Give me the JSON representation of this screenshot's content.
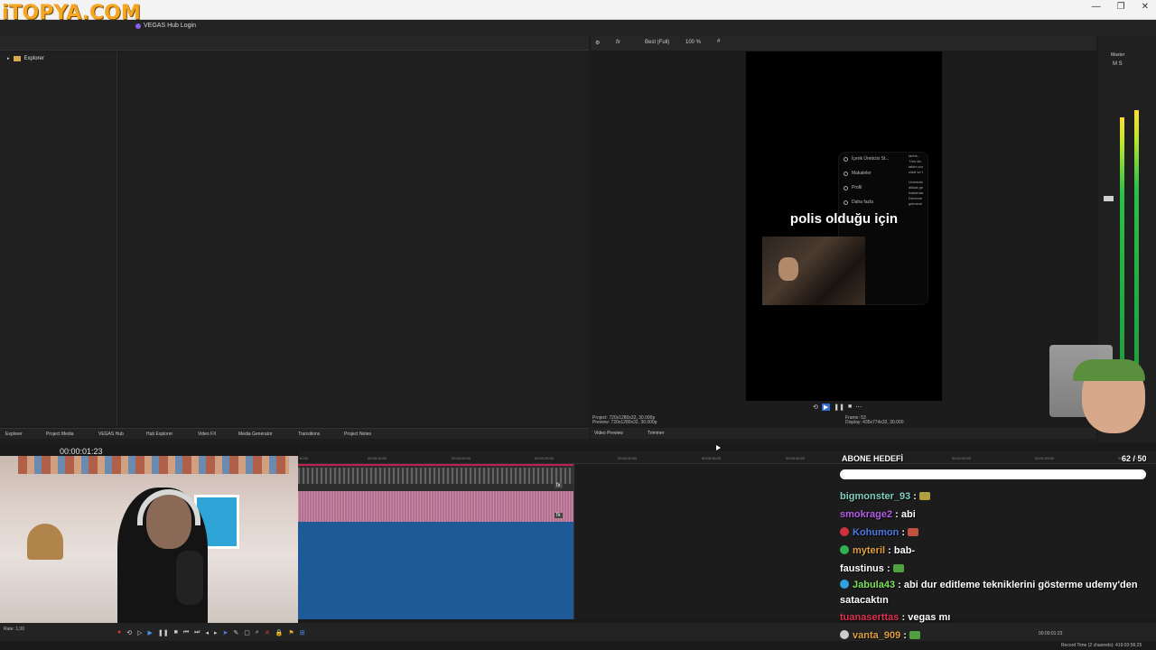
{
  "watermark": "iTOPYA.COM",
  "window": {
    "hub_login": "VEGAS Hub Login",
    "controls": [
      "—",
      "❐",
      "✕"
    ]
  },
  "explorer": {
    "tree_item": "Explorer"
  },
  "left_tabs": [
    "Explorer",
    "Project Media",
    "VEGAS Hub",
    "Hub Explorer",
    "Video FX",
    "Media Generator",
    "Transitions",
    "Project Notes"
  ],
  "preview": {
    "quality": "Best (Full)",
    "zoom": "100 %",
    "caption": "polis olduğu için",
    "menu_items": [
      "İçerik Üreticisi St...",
      "Makaleler",
      "Profil",
      "Daha fazla"
    ],
    "side_text": [
      "tarihs..",
      "Tüm da..",
      "takim sor",
      "ciddi ve f",
      "Uzmanla",
      "dikkat ge",
      "hakkinda",
      "Deneme",
      "gelmemi"
    ],
    "project_info": [
      "Project:  720x1280x32, 30.000p",
      "Preview:  720x1280x32, 30.000p"
    ],
    "frame_info": [
      "Frame:   53",
      "Display:   435x774x32, 30.000"
    ],
    "tabs": [
      "Video Preview",
      "Trimmer"
    ]
  },
  "master": {
    "label": "Master",
    "buttons": "M  S"
  },
  "timeline": {
    "timecode": "00:00:01:23",
    "ruler": [
      "00:00:10:00",
      "00:00:15:00",
      "00:00:20:00",
      "00:00:25:00",
      "00:00:30:00",
      "00:00:35:00",
      "00:00:40:00",
      "00:01:00:00",
      "00:01:05:00",
      "00:01:10:00"
    ],
    "fx_label": "fx"
  },
  "bottom": {
    "rate": "Rate: 1,00",
    "tc_right": "00:00:01:23",
    "record_time": "Record Time (2 channels): 419:03:56:25"
  },
  "stream": {
    "abone_label": "ABONE HEDEFİ",
    "abone_count": "62 / 50",
    "abone_progress": 1.0,
    "chat": [
      {
        "user": "bigmonster_93",
        "color": "#7fd0c0",
        "badge": "",
        "text": "",
        "emote": "#b0a040"
      },
      {
        "user": "smokrage2",
        "color": "#b25ce8",
        "badge": "",
        "text": "abi",
        "emote": ""
      },
      {
        "user": "Kohumon",
        "color": "#4a78e0",
        "badge": "#d03040",
        "text": "",
        "emote": "#c05040"
      },
      {
        "user": "myteril",
        "color": "#e0a040",
        "badge": "#30b050",
        "text": "bab-",
        "emote": ""
      },
      {
        "user": "faustinus",
        "color": "#ffffff",
        "badge": "",
        "text": "",
        "emote": "#50a040"
      },
      {
        "user": "Jabula43",
        "color": "#7fe060",
        "badge": "#30a0e0",
        "text": "abi dur editleme tekniklerini gösterme udemy'den satacaktın",
        "emote": ""
      },
      {
        "user": "tuanaserttas",
        "color": "#e03050",
        "badge": "",
        "text": "vegas mı",
        "emote": ""
      },
      {
        "user": "vanta_909",
        "color": "#e0a040",
        "badge": "#cccccc",
        "text": "",
        "emote": "#50a040"
      }
    ]
  }
}
